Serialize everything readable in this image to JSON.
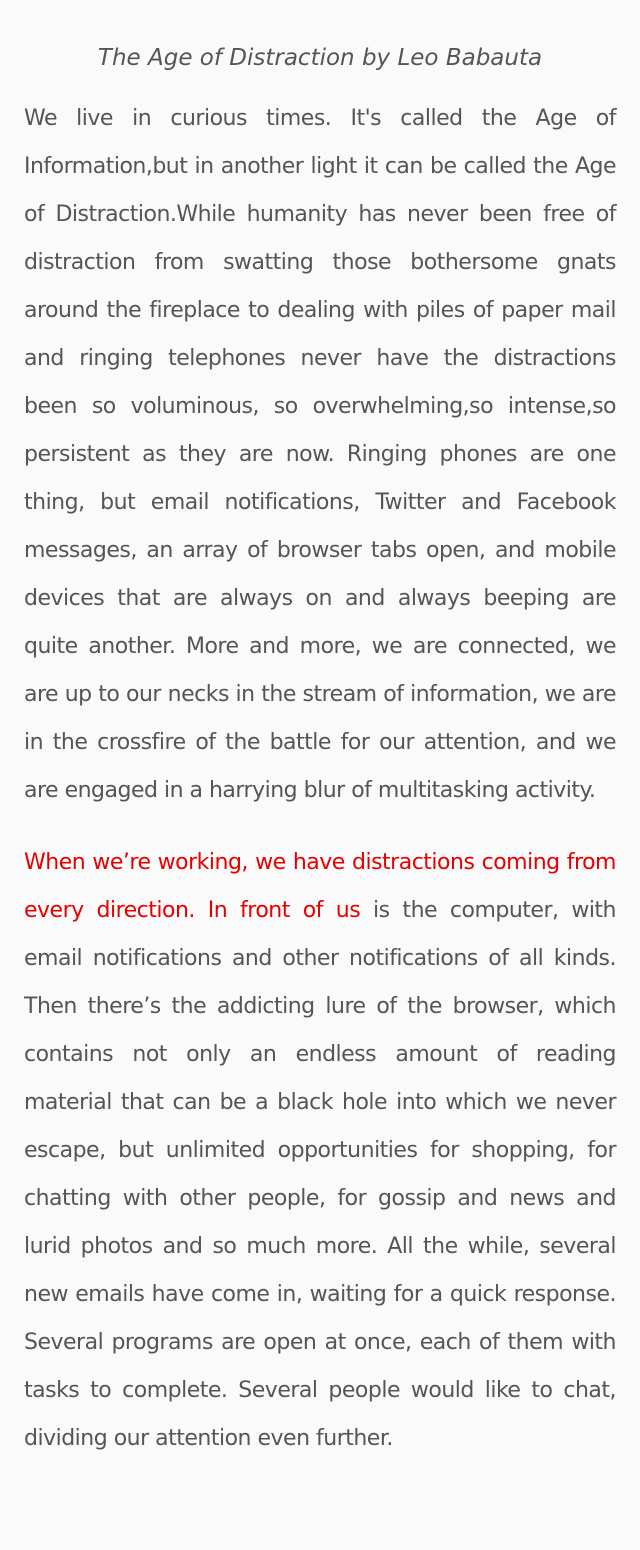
{
  "article": {
    "title": "The Age of Distraction by Leo Babauta",
    "paragraph1": "We live in curious times. It's called the Age of Information,but in another light it can be called the Age of Distraction.While humanity has never been free of distraction from swatting those bothersome gnats around the fireplace to dealing with piles of paper mail and ringing telephones never have the distractions been so voluminous, so overwhelming,so intense,so persistent as they are now. Ringing phones are one thing, but email notifications, Twitter and Facebook messages, an array of browser tabs open, and mobile devices that are always on and always beeping are quite another. More and more, we are connected, we are up to our necks in the stream of information, we are in the crossfire of the battle for our attention, and we are engaged in a harrying blur of multitasking activity.",
    "paragraph2_highlight": "When we’re working, we have distractions coming from every direction. In front of us",
    "paragraph2_rest": " is the computer, with email notifications and other notifications of all kinds. Then there’s the addicting lure of the browser, which contains not only an endless amount  of reading material that can be a black hole into which we never escape, but unlimited opportunities for shopping, for chatting with other people, for gossip and news and lurid photos and so much more. All the while, several new emails have come in, waiting for a quick response. Several programs are open at once, each of them with tasks to complete. Several people would like to chat, dividing our attention even further."
  },
  "colors": {
    "text": "#555555",
    "highlight": "#e60000",
    "background": "#fafafa"
  }
}
